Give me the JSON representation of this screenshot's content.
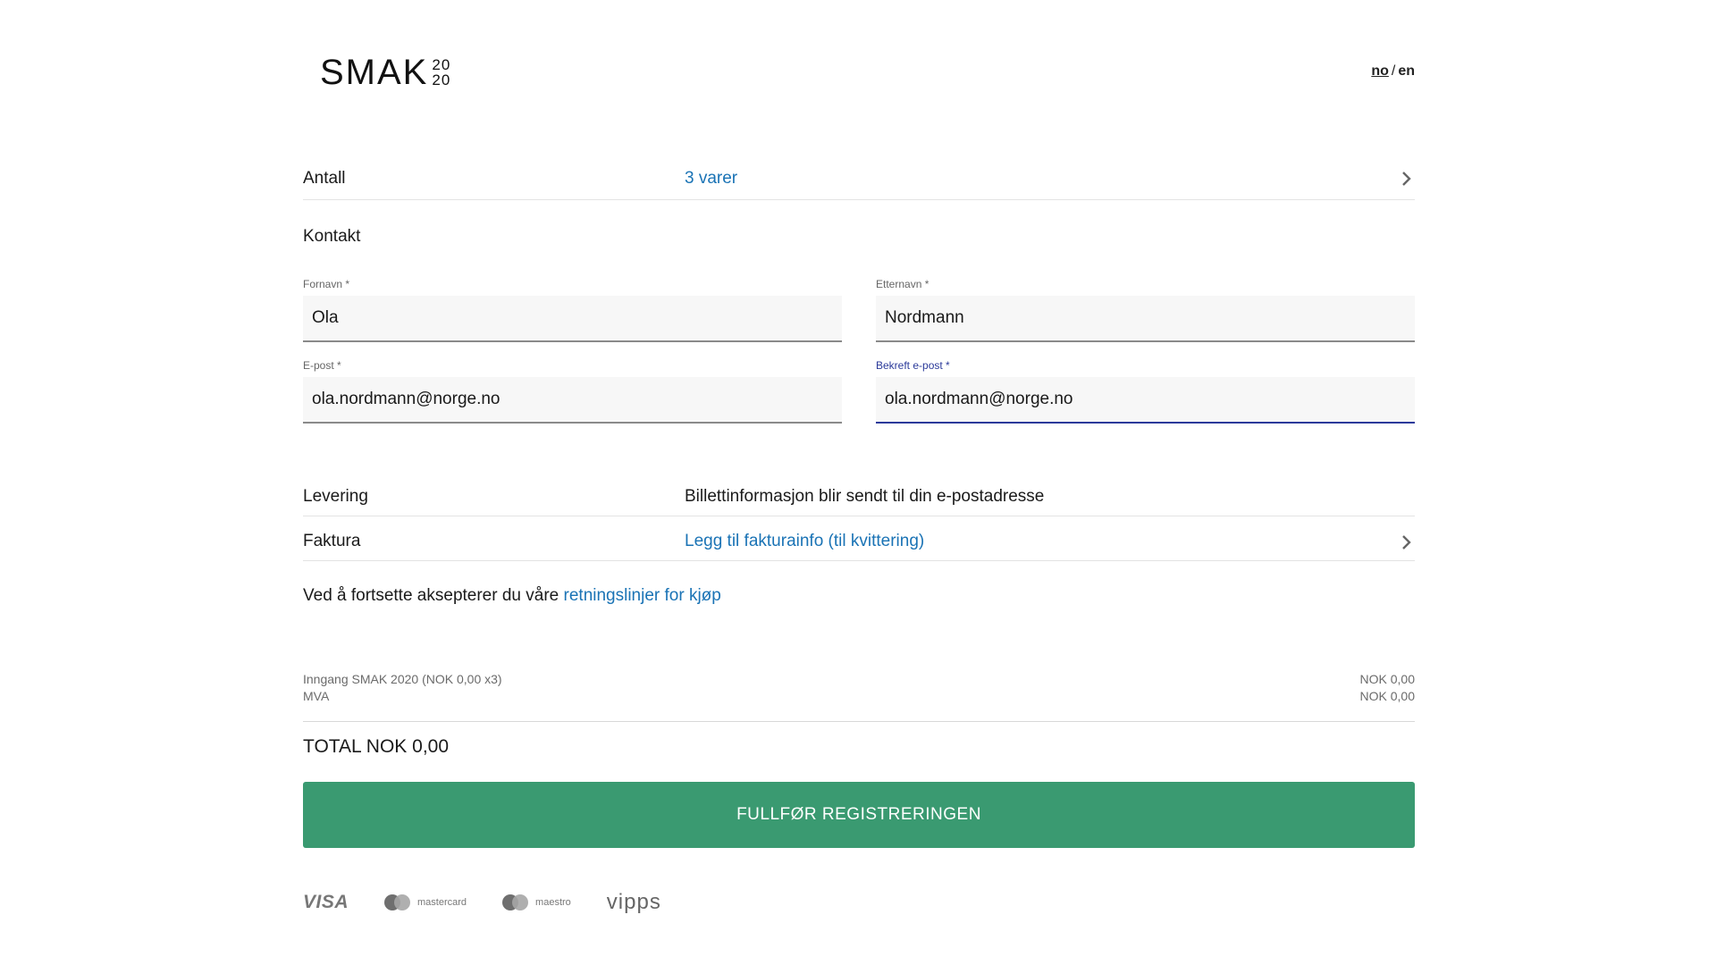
{
  "header": {
    "logo_text": "SMAK",
    "logo_year_top": "20",
    "logo_year_bottom": "20",
    "lang_no": "no",
    "lang_sep": "/",
    "lang_en": "en"
  },
  "antall": {
    "label": "Antall",
    "value": "3 varer"
  },
  "contact": {
    "title": "Kontakt",
    "first_name": {
      "label": "Fornavn *",
      "value": "Ola"
    },
    "last_name": {
      "label": "Etternavn *",
      "value": "Nordmann"
    },
    "email": {
      "label": "E-post *",
      "value": "ola.nordmann@norge.no"
    },
    "confirm_email": {
      "label": "Bekreft e-post *",
      "value": "ola.nordmann@norge.no"
    }
  },
  "levering": {
    "label": "Levering",
    "value": "Billettinformasjon blir sendt til din e-postadresse"
  },
  "faktura": {
    "label": "Faktura",
    "value": "Legg til fakturainfo (til kvittering)"
  },
  "terms": {
    "text": "Ved å fortsette aksepterer du våre ",
    "link": "retningslinjer for kjøp"
  },
  "summary": {
    "lines": [
      {
        "label": "Inngang SMAK 2020 (NOK 0,00 x3)",
        "amount": "NOK 0,00"
      },
      {
        "label": "MVA",
        "amount": "NOK 0,00"
      }
    ],
    "total": "TOTAL NOK 0,00"
  },
  "submit_label": "FULLFØR REGISTRERINGEN",
  "payments": {
    "visa": "VISA",
    "mastercard": "mastercard",
    "maestro": "maestro",
    "vipps": "vipps"
  },
  "colors": {
    "accent_green": "#3a9a71",
    "link_blue": "#1a73b5",
    "focus_blue": "#2b3a9a"
  }
}
